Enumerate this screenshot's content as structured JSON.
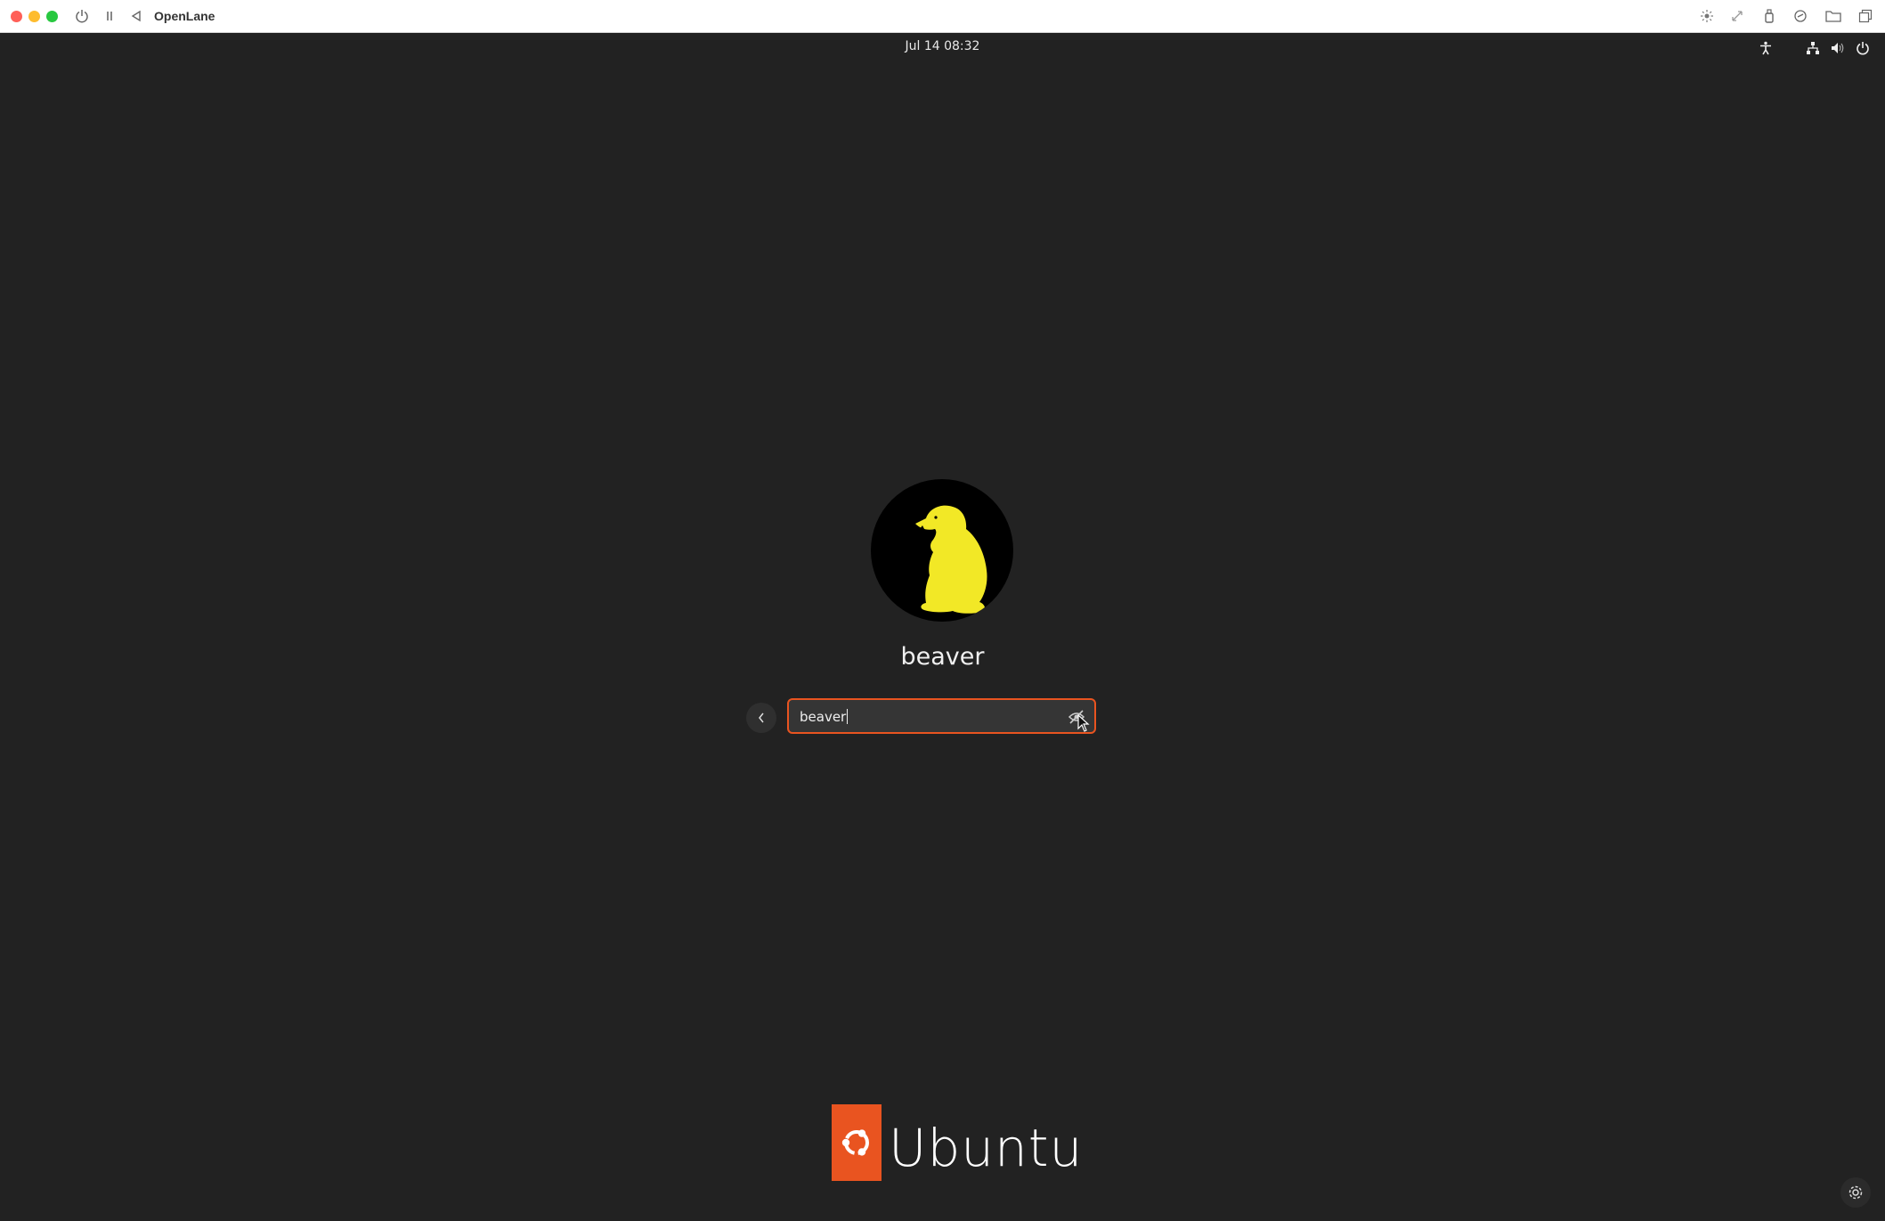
{
  "window": {
    "title": "OpenLane",
    "toolbar_icons": [
      "brightness-icon",
      "resize-icon",
      "usb-icon",
      "camera-icon",
      "folder-icon",
      "windows-icon"
    ]
  },
  "topbar": {
    "datetime": "Jul 14  08:32",
    "status_icons": [
      "accessibility-icon",
      "network-icon",
      "volume-icon",
      "power-icon"
    ]
  },
  "login": {
    "username": "beaver",
    "password_value": "beaver",
    "accent_color": "#e95420"
  },
  "brand": {
    "name": "Ubuntu",
    "color": "#e95420"
  }
}
